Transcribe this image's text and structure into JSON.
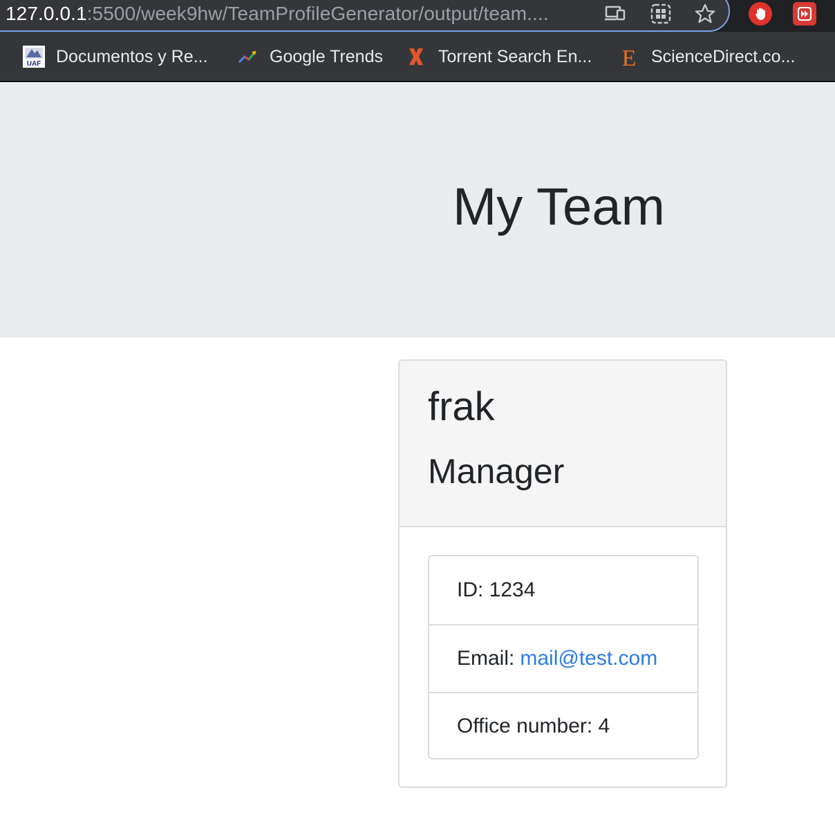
{
  "browser": {
    "url_host": "127.0.0.1",
    "url_rest": ":5500/week9hw/TeamProfileGenerator/output/team....",
    "toolbar_icons": [
      "cast-devices-icon",
      "tab-search-icon",
      "bookmark-star-icon"
    ],
    "extensions": [
      {
        "name": "adblock-hand-icon",
        "color": "#e0322c"
      },
      {
        "name": "red-fastforward-extension-icon",
        "color": "#d63a34"
      }
    ],
    "bookmarks": [
      {
        "label": "Documentos y Re...",
        "icon": "uaf-logo-icon"
      },
      {
        "label": "Google Trends",
        "icon": "google-trends-icon"
      },
      {
        "label": "Torrent Search En...",
        "icon": "torrent-x-icon"
      },
      {
        "label": "ScienceDirect.co...",
        "icon": "elsevier-e-icon"
      }
    ]
  },
  "page": {
    "title": "My Team"
  },
  "employee": {
    "name": "frak",
    "role": "Manager",
    "id_text": "ID: 1234",
    "email_label": "Email:",
    "email": "mail@test.com",
    "office_text": "Office number: 4"
  },
  "colors": {
    "jumbotron_bg": "#e9ecef",
    "link": "#2c7be5",
    "card_header_bg": "#f5f5f5"
  }
}
